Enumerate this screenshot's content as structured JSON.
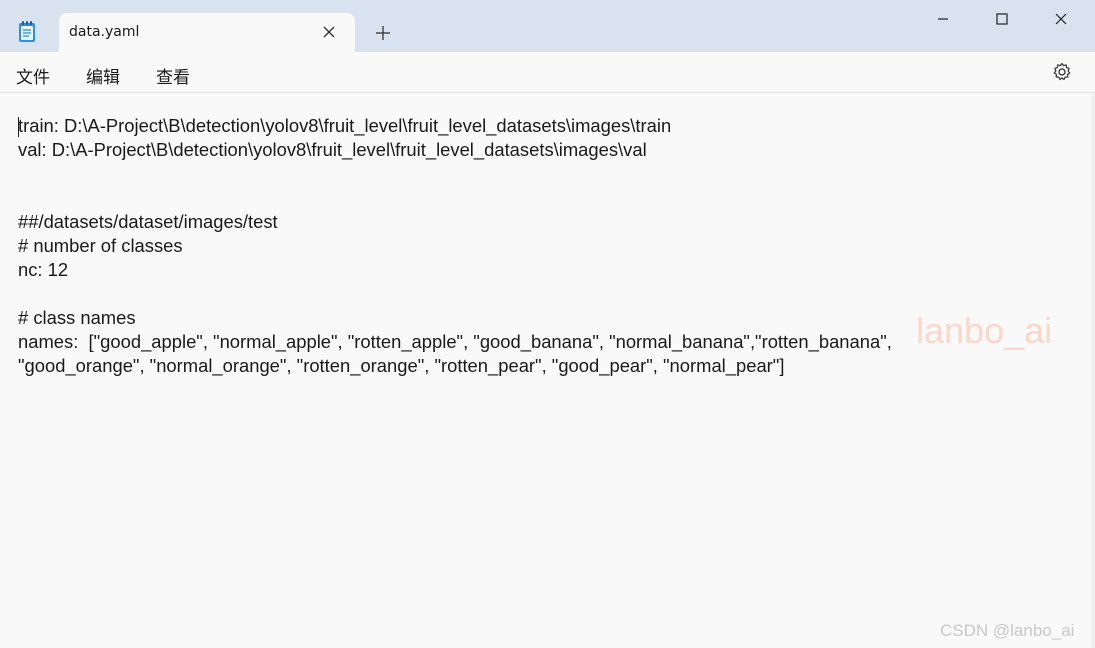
{
  "tab": {
    "title": "data.yaml"
  },
  "icons": {
    "app": "notepad-icon",
    "tab_close": "close-icon",
    "new_tab": "plus-icon",
    "minimize": "minimize-icon",
    "maximize": "maximize-icon",
    "close": "close-icon",
    "settings": "gear-icon"
  },
  "menu": {
    "file": "文件",
    "edit": "编辑",
    "view": "查看"
  },
  "editor": {
    "lines": [
      "train: D:\\A-Project\\B\\detection\\yolov8\\fruit_level\\fruit_level_datasets\\images\\train",
      "val: D:\\A-Project\\B\\detection\\yolov8\\fruit_level\\fruit_level_datasets\\images\\val",
      "",
      "",
      "##/datasets/dataset/images/test",
      "# number of classes",
      "nc: 12",
      "",
      "# class names",
      "names:  [\"good_apple\", \"normal_apple\", \"rotten_apple\", \"good_banana\", \"normal_banana\",\"rotten_banana\",",
      "\"good_orange\", \"normal_orange\", \"rotten_orange\", \"rotten_pear\", \"good_pear\", \"normal_pear\"]"
    ]
  },
  "watermark": "lanbo_ai",
  "footer_watermark": "CSDN @lanbo_ai",
  "colors": {
    "titlebar": "#d9e3ef",
    "editor_bg": "#f9f9f9",
    "text": "#1a1a1a"
  }
}
